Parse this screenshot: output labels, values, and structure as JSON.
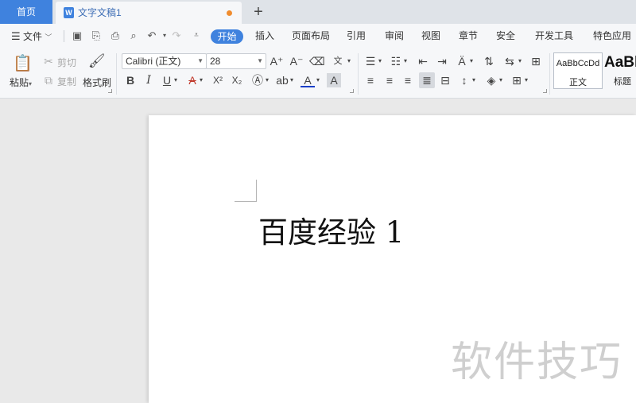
{
  "tabs": {
    "home_label": "首页",
    "doc_title": "文字文稿1",
    "doc_badge": "W",
    "add_glyph": "+"
  },
  "menu": {
    "file_label": "文件",
    "items": [
      "开始",
      "插入",
      "页面布局",
      "引用",
      "审阅",
      "视图",
      "章节",
      "安全",
      "开发工具",
      "特色应用"
    ],
    "active_index": 0
  },
  "ribbon": {
    "paste_label": "粘贴",
    "cut_label": "剪切",
    "copy_label": "复制",
    "format_painter_label": "格式刷",
    "font_name": "Calibri (正文)",
    "font_size": "28",
    "bold": "B",
    "italic": "I",
    "underline": "U",
    "strike": "A",
    "superscript": "X²",
    "subscript": "X₂",
    "font_grow": "A⁺",
    "font_shrink": "A⁻",
    "style_normal_sample": "AaBbCcDd",
    "style_normal_name": "正文",
    "style_title_sample": "AaBl",
    "style_title_name": "标题"
  },
  "document": {
    "text": "百度经验 1",
    "watermark": "软件技巧"
  },
  "colors": {
    "accent": "#3f82de",
    "unsaved_dot": "#f08c2e"
  }
}
